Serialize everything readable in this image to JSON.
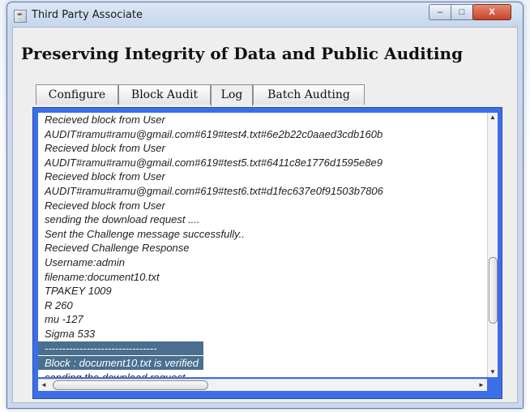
{
  "window": {
    "title": "Third Party Associate",
    "app_icon": "java-cup-icon",
    "controls": {
      "minimize": "–",
      "maximize": "□",
      "close": "X"
    }
  },
  "heading": "Preserving Integrity of Data and Public Auditing",
  "tabs": [
    {
      "label": "Configure",
      "active": false
    },
    {
      "label": "Block Audit",
      "active": false
    },
    {
      "label": "Log",
      "active": true
    },
    {
      "label": "Batch Audting",
      "active": false
    }
  ],
  "log": {
    "lines": [
      "Recieved block from User",
      "AUDIT#ramu#ramu@gmail.com#619#test4.txt#6e2b22c0aaed3cdb160b",
      "Recieved block from User",
      "AUDIT#ramu#ramu@gmail.com#619#test5.txt#6411c8e1776d1595e8e9",
      "Recieved block from User",
      "AUDIT#ramu#ramu@gmail.com#619#test6.txt#d1fec637e0f91503b7806",
      "Recieved block from User",
      "sending the download request ....",
      "Sent the Challenge message successfully..",
      "Recieved Challenge Response",
      "Username:admin",
      "filename:document10.txt",
      "TPAKEY 1009",
      "R 260",
      "mu -127",
      "Sigma 533",
      "--------------------------------",
      "Block : document10.txt is verified",
      "sending the download request ...."
    ]
  },
  "scrollbar_arrows": {
    "up": "▲",
    "down": "▼",
    "left": "◄",
    "right": "►"
  }
}
